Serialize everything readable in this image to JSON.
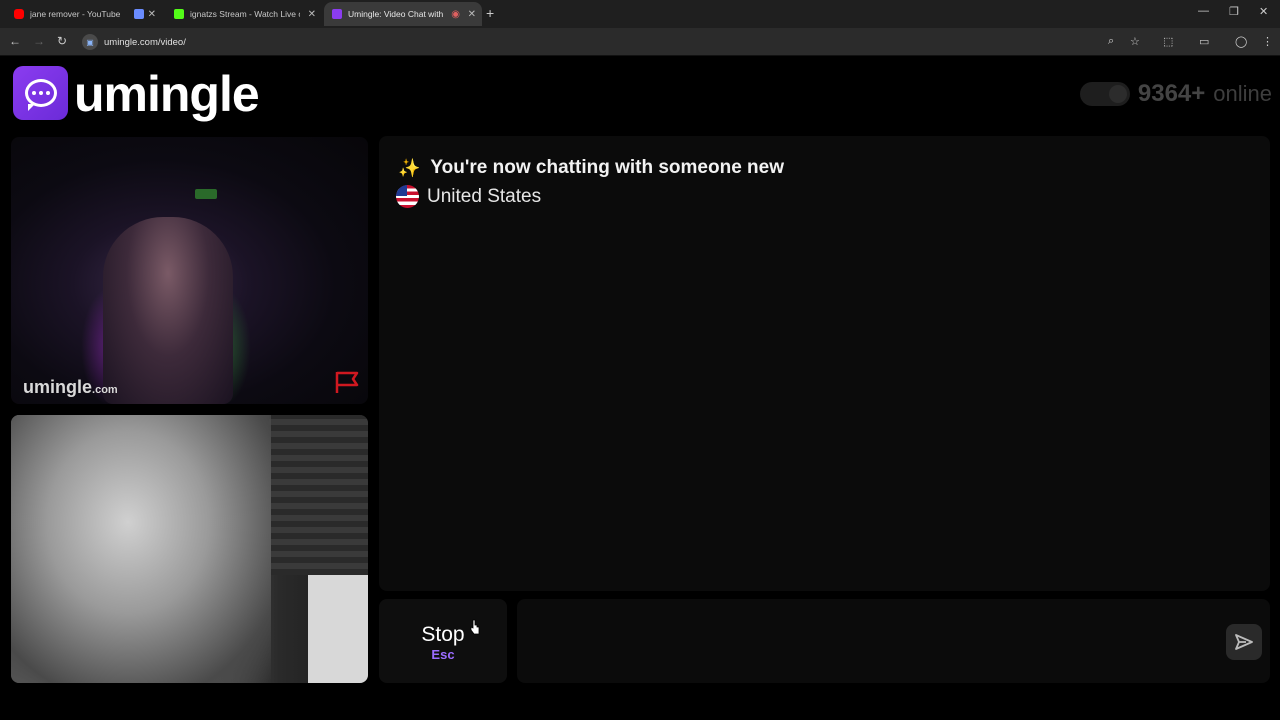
{
  "browser": {
    "tabs": [
      {
        "title": "jane remover - YouTube",
        "favicon_color": "#ff0000"
      },
      {
        "title": "",
        "favicon_color": "#6a8cff"
      },
      {
        "title": "ignatzs Stream - Watch Live on",
        "favicon_color": "#53fc18"
      },
      {
        "title": "Umingle: Video Chat with S",
        "favicon_color": "#8b3cf0"
      }
    ],
    "new_tab": "+",
    "url": "umingle.com/video/"
  },
  "header": {
    "brand": "umingle",
    "online_count": "9364+",
    "online_label": "online"
  },
  "remote_video": {
    "watermark": "umingle",
    "watermark_suffix": ".com"
  },
  "chat": {
    "status_message": "You're now chatting with someone new",
    "sparkle": "✨",
    "country": "United States"
  },
  "controls": {
    "stop_label": "Stop",
    "stop_shortcut": "Esc",
    "message_value": ""
  },
  "colors": {
    "brand_purple": "#8b3cf0",
    "esc_purple": "#9b6cff",
    "report_red": "#d01820"
  }
}
